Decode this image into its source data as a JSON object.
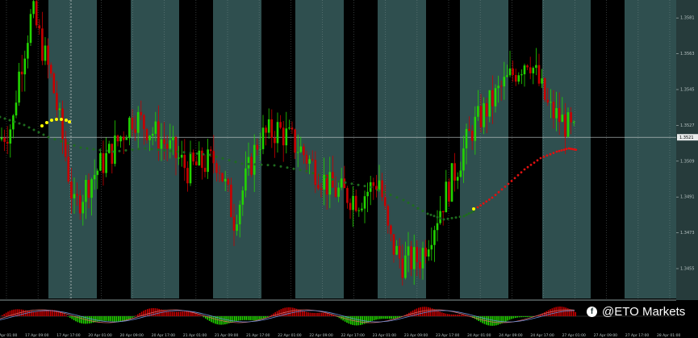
{
  "chart_data": {
    "type": "candlestick",
    "title": "",
    "y_ticks": [
      "1.3581",
      "1.3563",
      "1.3545",
      "1.3527",
      "1.3509",
      "1.3491",
      "1.3473",
      "1.3455"
    ],
    "y_range": [
      1.344,
      1.359
    ],
    "current_price": "1.3521",
    "x_ticks": [
      "17 Apr 01:00",
      "17 Apr 09:00",
      "17 Apr 17:00",
      "20 Apr 01:00",
      "20 Apr 09:00",
      "20 Apr 17:00",
      "21 Apr 01:00",
      "21 Apr 09:00",
      "21 Apr 17:00",
      "22 Apr 01:00",
      "22 Apr 09:00",
      "22 Apr 17:00",
      "23 Apr 01:00",
      "23 Apr 09:00",
      "23 Apr 17:00",
      "24 Apr 01:00",
      "24 Apr 09:00",
      "24 Apr 17:00",
      "27 Apr 01:00",
      "27 Apr 09:00",
      "27 Apr 17:00",
      "28 Apr 01:00"
    ],
    "ohlc": [],
    "moving_average": [],
    "signal_line": []
  },
  "watermark": {
    "icon": "facebook-icon",
    "text": "@ETO Markets"
  },
  "colors": {
    "background": "#000000",
    "stripe": "#2f4f4f",
    "bull": "#22d400",
    "bear": "#c80000",
    "ma": "#1e6b1e",
    "signal_up": "#ffff00",
    "signal_down": "#e01010",
    "grid": "#9aa8a8",
    "text": "#b8c4c4"
  }
}
